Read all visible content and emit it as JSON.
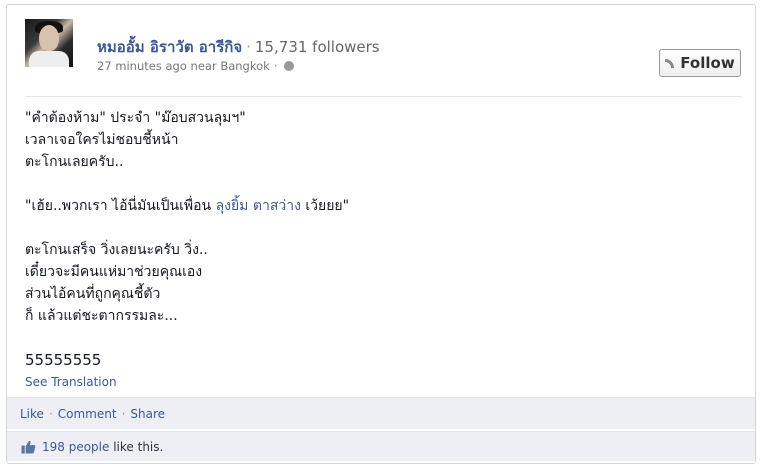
{
  "post": {
    "author_name": "หมออั้ม อิราวัต อารีกิจ",
    "followers": "15,731 followers",
    "time_location": "27 minutes ago near Bangkok",
    "follow_label": "Follow",
    "lines": {
      "l1": "\"คำต้องห้าม\" ประจำ \"ม๊อบสวนลุมฯ\"",
      "l2": "เวลาเจอใครไม่ชอบชี้หน้า",
      "l3": "ตะโกนเลยครับ..",
      "l4_pre": "\"เฮ้ย..พวกเรา ไอ้นี่มันเป็นเพื่อน ",
      "l4_link": "ลุงยิ้ม ตาสว่าง",
      "l4_post": " เว้ยยย\"",
      "l5": "ตะโกนเสร็จ วิ่งเลยนะครับ วิ่ง..",
      "l6": "เดี๋ยวจะมีคนแห่มาช่วยคุณเอง",
      "l7": "ส่วนไอ้คนที่ถูกคุณชี้ตัว",
      "l8": "ก็ แล้วแต่ชะตากรรมละ...",
      "l9": "55555555"
    },
    "see_translation": "See Translation"
  },
  "actions": {
    "like": "Like",
    "comment": "Comment",
    "share": "Share"
  },
  "likes": {
    "count_text": "198 people",
    "suffix": " like this."
  },
  "icons": {
    "globe": "globe-icon",
    "rss": "rss-icon",
    "thumb": "thumbs-up-icon"
  },
  "colors": {
    "link": "#3b5998",
    "action_bar": "#edeff4"
  }
}
